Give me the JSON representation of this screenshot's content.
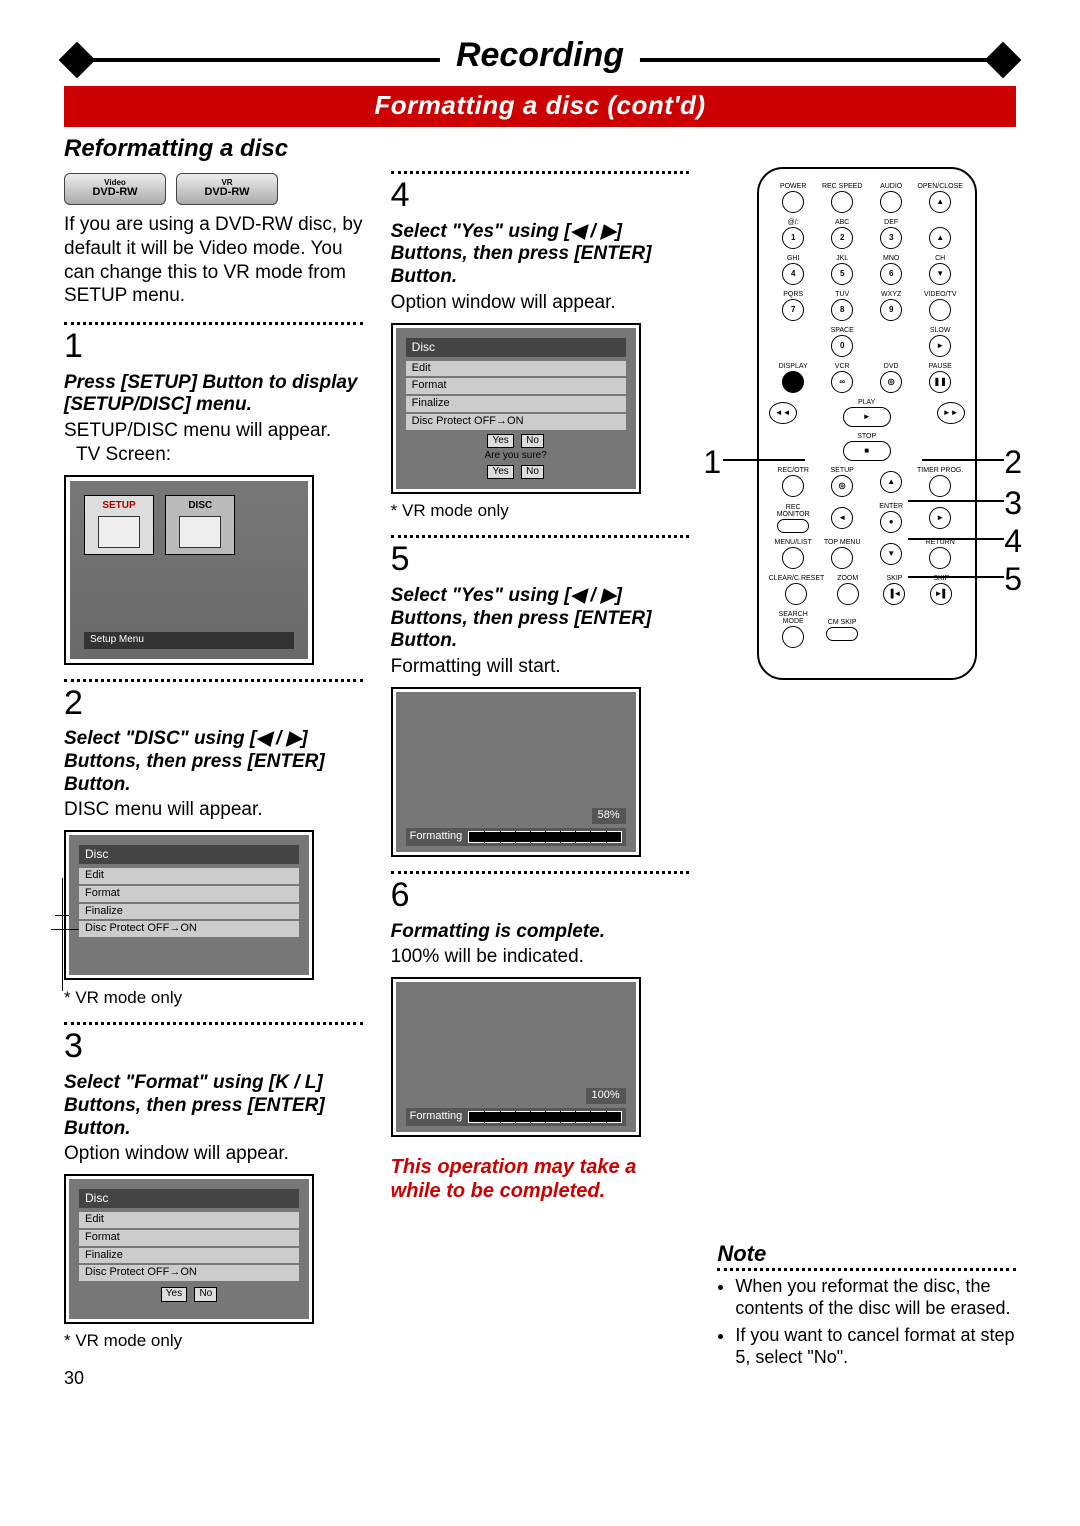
{
  "header": {
    "section_title": "Recording",
    "redband": "Formatting a disc (cont'd)",
    "subhead": "Reformatting a disc"
  },
  "badges": {
    "video": {
      "small": "Video",
      "big": "DVD-RW"
    },
    "vr": {
      "small": "VR",
      "big": "DVD-RW"
    }
  },
  "intro": "If you are using a DVD-RW disc, by default it will be Video mode. You can change this to VR mode from SETUP menu.",
  "steps": {
    "1": {
      "num": "1",
      "instr": "Press [SETUP] Button to display [SETUP/DISC] menu.",
      "sub": "SETUP/DISC menu will appear.",
      "screen_label": "TV Screen:",
      "tab_setup": "SETUP",
      "tab_disc": "DISC",
      "setup_menu": "Setup Menu"
    },
    "2": {
      "num": "2",
      "instr": "Select \"DISC\" using [◀ / ▶] Buttons, then press [ENTER] Button.",
      "sub": "DISC menu will appear.",
      "footnote": "* VR mode only"
    },
    "3": {
      "num": "3",
      "instr": "Select \"Format\" using [K / L] Buttons, then press [ENTER] Button.",
      "sub": "Option window will appear.",
      "footnote": "* VR mode only"
    },
    "4": {
      "num": "4",
      "instr": "Select \"Yes\" using [◀ / ▶] Buttons, then press [ENTER] Button.",
      "sub": "Option window will appear.",
      "footnote": "* VR mode only"
    },
    "5": {
      "num": "5",
      "instr": "Select \"Yes\" using [◀ / ▶] Buttons, then press [ENTER] Button.",
      "sub": "Formatting will start."
    },
    "6": {
      "num": "6",
      "instr": "Formatting is complete.",
      "sub": "100% will be indicated."
    }
  },
  "disc_menu": {
    "title": "Disc",
    "items": [
      "Edit",
      "Format",
      "Finalize",
      "Disc Protect OFF→ON"
    ],
    "yes": "Yes",
    "no": "No",
    "confirm": "Are you sure?"
  },
  "progress": {
    "label": "Formatting",
    "pct58": "58%",
    "pct100": "100%"
  },
  "warning": "This operation may take a while to be completed.",
  "note": {
    "title": "Note",
    "items": [
      "When you reformat the disc, the contents of the disc will be erased.",
      "If you want to cancel format at step 5, select \"No\"."
    ]
  },
  "remote": {
    "row1": [
      "POWER",
      "REC SPEED",
      "AUDIO",
      "OPEN/CLOSE"
    ],
    "numpad_labels": [
      "@/:",
      "ABC",
      "DEF",
      "GHI",
      "JKL",
      "MNO",
      "PQRS",
      "TUV",
      "WXYZ",
      "SPACE"
    ],
    "numpad_nums": [
      "1",
      "2",
      "3",
      "4",
      "5",
      "6",
      "7",
      "8",
      "9",
      "0"
    ],
    "sidecol": [
      "▲",
      "CH",
      "▼",
      "VIDEO/TV",
      "SLOW"
    ],
    "row_dvp": [
      "DISPLAY",
      "VCR",
      "DVD",
      "PAUSE"
    ],
    "play": "PLAY",
    "stop": "STOP",
    "rew": "◄◄",
    "ff": "►►",
    "row_rec": [
      "REC/OTR",
      "SETUP",
      "TIMER PROG."
    ],
    "row_menu": [
      "REC MONITOR",
      "ENTER"
    ],
    "row_ml": [
      "MENU/LIST",
      "TOP MENU",
      "RETURN"
    ],
    "row_skip": [
      "CLEAR/C.RESET",
      "ZOOM",
      "SKIP",
      "SKIP"
    ],
    "row_bottom": [
      "SEARCH MODE",
      "CM SKIP"
    ]
  },
  "callouts": {
    "1": "1",
    "2": "2",
    "3": "3",
    "4": "4",
    "5": "5"
  },
  "page_number": "30"
}
